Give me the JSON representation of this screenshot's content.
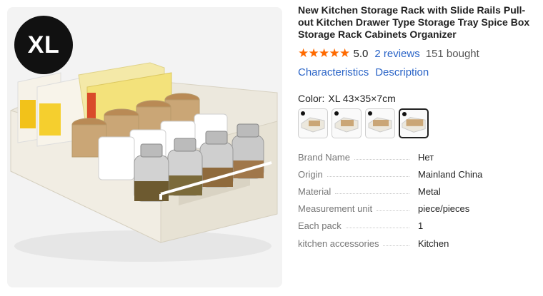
{
  "image": {
    "badge": "XL"
  },
  "product": {
    "title": "New Kitchen Storage Rack with Slide Rails Pull-out Kitchen Drawer Type Storage Tray Spice Box Storage Rack Cabinets Organizer",
    "rating": "5.0",
    "stars": 5,
    "reviews": "2 reviews",
    "bought": "151 bought"
  },
  "tabs": [
    "Characteristics",
    "Description"
  ],
  "color": {
    "label": "Color:",
    "selected": "XL 43×35×7cm",
    "options_count": 4,
    "selected_index": 3
  },
  "specs": [
    {
      "name": "Brand Name",
      "value": "Нет"
    },
    {
      "name": "Origin",
      "value": "Mainland China"
    },
    {
      "name": "Material",
      "value": "Metal"
    },
    {
      "name": "Measurement unit",
      "value": "piece/pieces"
    },
    {
      "name": "Each pack",
      "value": "1"
    },
    {
      "name": "kitchen accessories",
      "value": "Kitchen"
    }
  ],
  "colors": {
    "star": "#ff6a00",
    "link": "#2a64c7"
  }
}
